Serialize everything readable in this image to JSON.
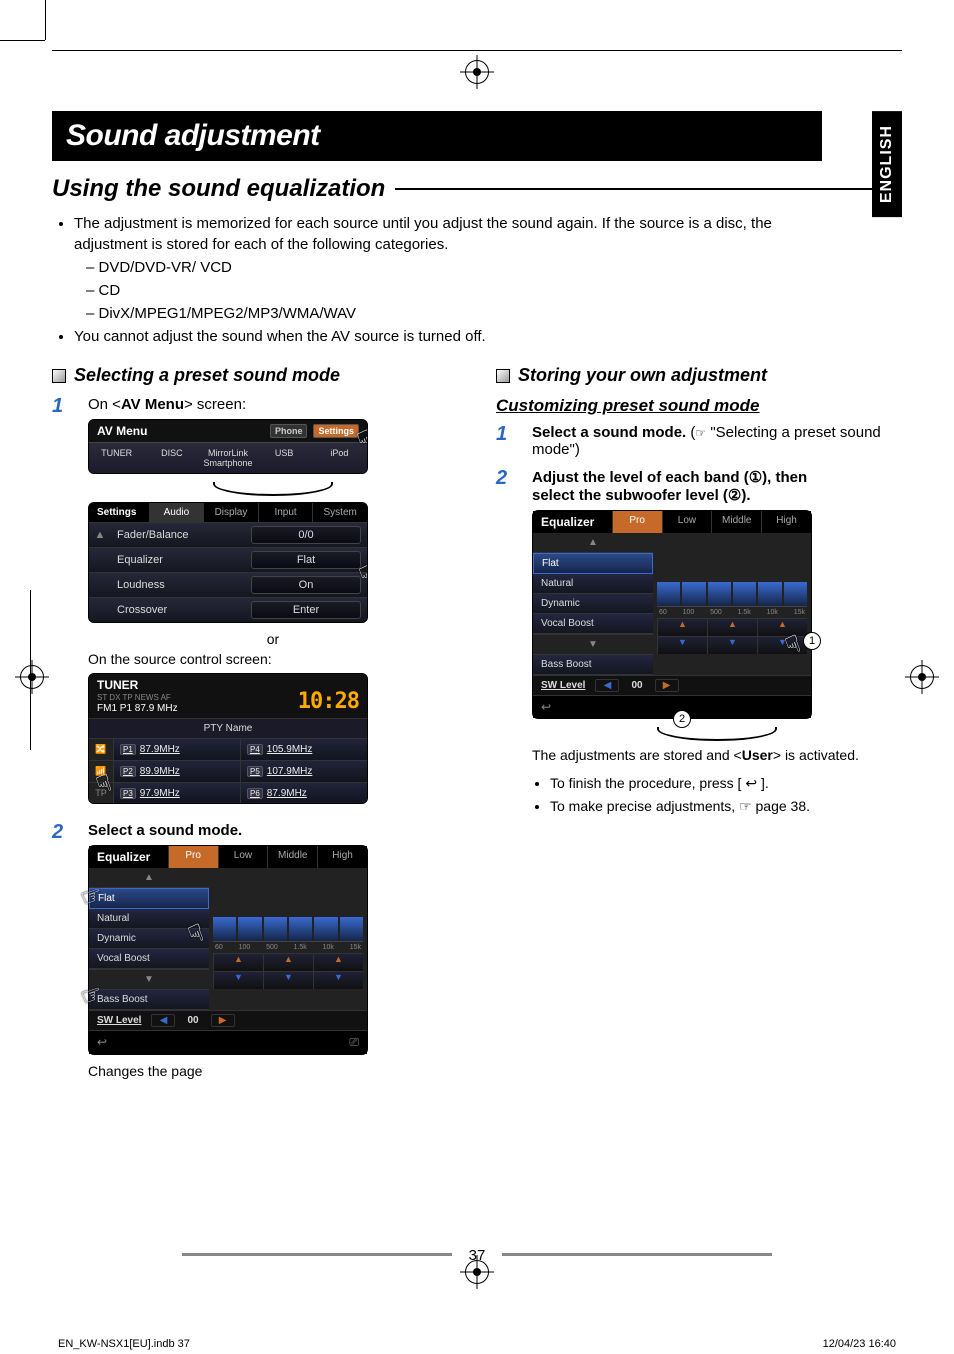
{
  "lang_tab": "ENGLISH",
  "title": "Sound adjustment",
  "section_heading": "Using the sound equalization",
  "bullets": {
    "memo": "The adjustment is memorized for each source until you adjust the sound again. If the source is a disc, the adjustment is stored for each of the following categories.",
    "cats": [
      "DVD/DVD-VR/ VCD",
      "CD",
      "DivX/MPEG1/MPEG2/MP3/WMA/WAV"
    ],
    "avoff": "You cannot adjust the sound when the AV source is turned off."
  },
  "left": {
    "subhead": "Selecting a preset sound mode",
    "step1": {
      "pre": "On <",
      "bold": "AV Menu",
      "post": "> screen:"
    },
    "avmenu": {
      "title": "AV Menu",
      "chips": [
        "Phone",
        "Settings"
      ],
      "cells": [
        "TUNER",
        "DISC",
        "MirrorLink Smartphone",
        "USB",
        "iPod"
      ]
    },
    "settings": {
      "title": "Settings",
      "tabs": [
        "Audio",
        "Display",
        "Input",
        "System"
      ],
      "rows": [
        {
          "label": "Fader/Balance",
          "value": "0/0"
        },
        {
          "label": "Equalizer",
          "value": "Flat"
        },
        {
          "label": "Loudness",
          "value": "On"
        },
        {
          "label": "Crossover",
          "value": "Enter"
        }
      ]
    },
    "or": "or",
    "or_caption": "On the source control screen:",
    "tuner": {
      "title": "TUNER",
      "band": "FM1",
      "preset_badge": "P1",
      "freq": "87.9 MHz",
      "icons": "ST  DX  TP  NEWS  AF",
      "clock": "10:28",
      "pty": "PTY Name",
      "side": [
        "🔀",
        "📶",
        "TP"
      ],
      "cells": [
        {
          "p": "P1",
          "f": "87.9MHz"
        },
        {
          "p": "P4",
          "f": "105.9MHz"
        },
        {
          "p": "P2",
          "f": "89.9MHz"
        },
        {
          "p": "P5",
          "f": "107.9MHz"
        },
        {
          "p": "P3",
          "f": "97.9MHz"
        },
        {
          "p": "P6",
          "f": "87.9MHz"
        }
      ]
    },
    "step2": "Select a sound mode.",
    "eq": {
      "title": "Equalizer",
      "tabs": [
        "Pro",
        "Low",
        "Middle",
        "High"
      ],
      "modes": [
        "Flat",
        "Natural",
        "Dynamic",
        "Vocal Boost",
        "Bass Boost"
      ],
      "axis": [
        "60",
        "100",
        "500",
        "1.5k",
        "10k",
        "15k"
      ],
      "sw_label": "SW Level",
      "sw_value": "00"
    },
    "caption": "Changes the page"
  },
  "right": {
    "subhead": "Storing your own adjustment",
    "underline": "Customizing preset sound mode",
    "step1": {
      "bold": "Select a sound mode.",
      "post_pre": " (",
      "post_post": " \"Selecting a preset sound mode\")"
    },
    "step2_l1": "Adjust the level of each band (①), then",
    "step2_l2": "select the subwoofer level (②).",
    "eq": {
      "title": "Equalizer",
      "tabs": [
        "Pro",
        "Low",
        "Middle",
        "High"
      ],
      "modes": [
        "Flat",
        "Natural",
        "Dynamic",
        "Vocal Boost",
        "Bass Boost"
      ],
      "axis": [
        "60",
        "100",
        "500",
        "1.5k",
        "10k",
        "15k"
      ],
      "sw_label": "SW Level",
      "sw_value": "00"
    },
    "stored_pre": "The adjustments are stored and <",
    "stored_bold": "User",
    "stored_post": "> is activated.",
    "bullets": [
      "To finish the procedure, press [  ↩  ].",
      "To make precise adjustments, ☞ page 38."
    ]
  },
  "page_number": "37",
  "footer_left": "EN_KW-NSX1[EU].indb   37",
  "footer_right": "12/04/23   16:40"
}
